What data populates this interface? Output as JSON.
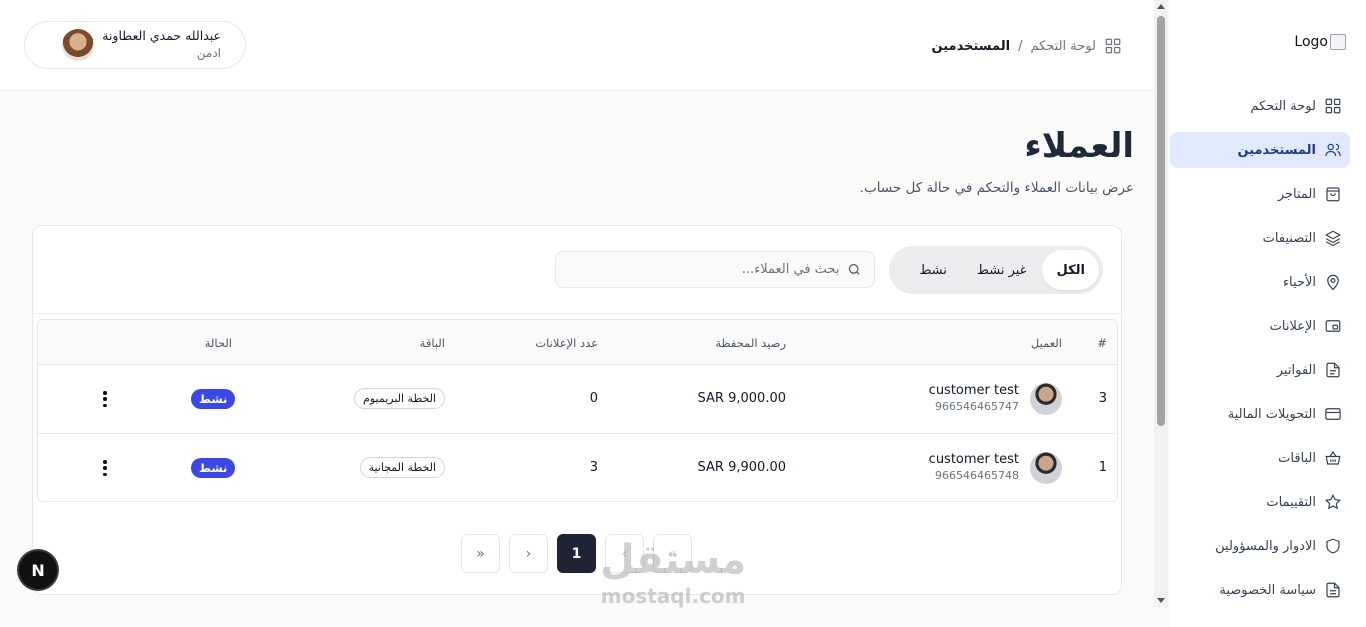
{
  "sidebar": {
    "logo_alt": "Logo",
    "items": [
      {
        "label": "لوحة التحكم",
        "icon": "grid-icon"
      },
      {
        "label": "المستخدمين",
        "icon": "users-icon",
        "active": true
      },
      {
        "label": "المتاجر",
        "icon": "shopping-bag-icon"
      },
      {
        "label": "التصنيفات",
        "icon": "layers-icon"
      },
      {
        "label": "الأحياء",
        "icon": "map-pin-icon"
      },
      {
        "label": "الإعلانات",
        "icon": "ads-icon"
      },
      {
        "label": "الفواتير",
        "icon": "file-text-icon"
      },
      {
        "label": "التحويلات المالية",
        "icon": "credit-card-icon"
      },
      {
        "label": "الباقات",
        "icon": "basket-icon"
      },
      {
        "label": "التقييمات",
        "icon": "star-icon"
      },
      {
        "label": "الادوار والمسؤولين",
        "icon": "shield-icon"
      },
      {
        "label": "سياسة الخصوصية",
        "icon": "document-icon"
      }
    ]
  },
  "header": {
    "breadcrumb": {
      "root": "لوحة التحكم",
      "separator": "/",
      "current": "المستخدمين"
    },
    "user": {
      "name": "عبدالله حمدي العطاونة",
      "role": "ادمن"
    }
  },
  "page": {
    "title": "العملاء",
    "subtitle": "عرض بيانات العملاء والتحكم في حالة كل حساب."
  },
  "filters": {
    "all": "الكل",
    "inactive": "غير نشط",
    "active": "نشط"
  },
  "search": {
    "placeholder": "بحث في العملاء...",
    "value": ""
  },
  "table": {
    "headers": {
      "index": "#",
      "customer": "العميل",
      "balance": "رصيد المحفظة",
      "ads_count": "عدد الإعلانات",
      "plan": "الباقة",
      "status": "الحالة"
    },
    "rows": [
      {
        "index": "3",
        "name": "customer test",
        "phone": "966546465747",
        "balance": "SAR 9,000.00",
        "ads_count": "0",
        "plan": "الخطة البريميوم",
        "status": "نشط"
      },
      {
        "index": "1",
        "name": "customer test",
        "phone": "966546465748",
        "balance": "SAR 9,900.00",
        "ads_count": "3",
        "plan": "الخطة المجانية",
        "status": "نشط"
      }
    ]
  },
  "pagination": {
    "first": "«",
    "prev": "‹",
    "current": "1",
    "next": "›",
    "last": "»"
  },
  "floating_badge": "N",
  "watermark": {
    "arabic": "مستقل",
    "latin": "mostaql.com"
  },
  "colors": {
    "accent": "#3b48e6",
    "active_nav_bg": "#e0e9ff",
    "active_page": "#1f2333"
  }
}
